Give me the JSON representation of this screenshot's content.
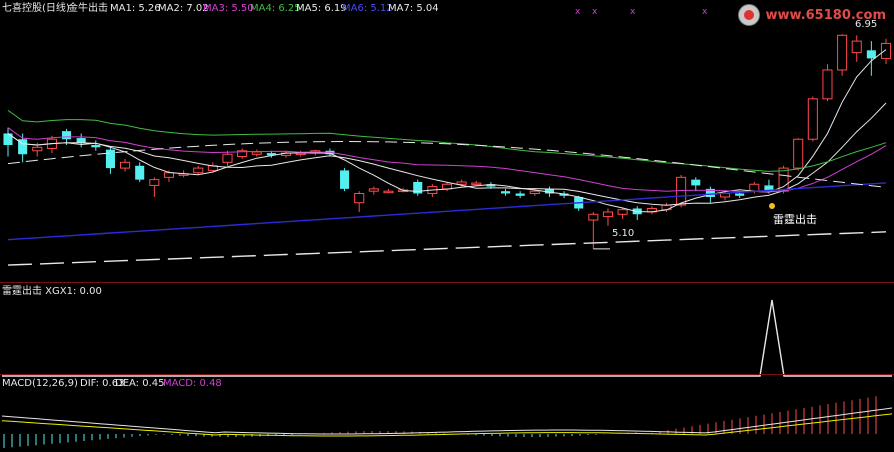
{
  "main_legend": {
    "stock": "七喜控股(日线)",
    "indicator": "金牛出击",
    "ma1": "MA1: 5.26",
    "ma2": "MA2: 7.02",
    "ma3": "MA3: 5.50",
    "ma4": "MA4: 6.25",
    "ma5": "MA5: 6.19",
    "ma6": "MA6: 5.12",
    "ma7": "MA7: 5.04"
  },
  "watermark": "www.65180.com",
  "annotations": {
    "high_price": "6.95",
    "low_price": "5.10",
    "signal": "雷霆出击"
  },
  "sub_pane1": {
    "legend": "雷霆出击 XGX1: 0.00"
  },
  "sub_pane2": {
    "legend_name": "MACD(12,26,9)",
    "dif": "DIF: 0.63",
    "dea": "DEA: 0.45",
    "macd": "MACD: 0.48"
  },
  "colors": {
    "up": "#ff4a4a",
    "down": "#54f0f0",
    "ma_white": "#e8e8e8",
    "ma_purple": "#d040d0",
    "ma_green": "#3fbf3f",
    "ma_blue": "#2b2bd8",
    "pane_border": "#7a1010"
  },
  "chart_data": {
    "type": "candlestick",
    "price_range": [
      4.9,
      7.1
    ],
    "candles": [
      {
        "o": 6.0,
        "c": 6.1,
        "h": 6.15,
        "l": 5.9,
        "up": false
      },
      {
        "o": 6.05,
        "c": 5.92,
        "h": 6.1,
        "l": 5.85,
        "up": false
      },
      {
        "o": 5.95,
        "c": 5.98,
        "h": 6.02,
        "l": 5.9,
        "up": true
      },
      {
        "o": 5.97,
        "c": 6.05,
        "h": 6.08,
        "l": 5.93,
        "up": true
      },
      {
        "o": 6.12,
        "c": 6.05,
        "h": 6.14,
        "l": 6.0,
        "up": false
      },
      {
        "o": 6.06,
        "c": 6.02,
        "h": 6.1,
        "l": 5.98,
        "up": false
      },
      {
        "o": 6.0,
        "c": 5.98,
        "h": 6.04,
        "l": 5.95,
        "up": false
      },
      {
        "o": 5.96,
        "c": 5.8,
        "h": 5.98,
        "l": 5.75,
        "up": false
      },
      {
        "o": 5.8,
        "c": 5.85,
        "h": 5.88,
        "l": 5.77,
        "up": true
      },
      {
        "o": 5.82,
        "c": 5.7,
        "h": 5.85,
        "l": 5.68,
        "up": false
      },
      {
        "o": 5.65,
        "c": 5.7,
        "h": 5.72,
        "l": 5.55,
        "up": true
      },
      {
        "o": 5.72,
        "c": 5.76,
        "h": 5.78,
        "l": 5.68,
        "up": true
      },
      {
        "o": 5.74,
        "c": 5.75,
        "h": 5.78,
        "l": 5.72,
        "up": true
      },
      {
        "o": 5.76,
        "c": 5.8,
        "h": 5.82,
        "l": 5.74,
        "up": true
      },
      {
        "o": 5.78,
        "c": 5.82,
        "h": 5.85,
        "l": 5.76,
        "up": true
      },
      {
        "o": 5.85,
        "c": 5.92,
        "h": 5.95,
        "l": 5.82,
        "up": true
      },
      {
        "o": 5.9,
        "c": 5.95,
        "h": 5.97,
        "l": 5.88,
        "up": true
      },
      {
        "o": 5.92,
        "c": 5.94,
        "h": 5.96,
        "l": 5.9,
        "up": true
      },
      {
        "o": 5.93,
        "c": 5.91,
        "h": 5.95,
        "l": 5.89,
        "up": false
      },
      {
        "o": 5.91,
        "c": 5.93,
        "h": 5.95,
        "l": 5.89,
        "up": true
      },
      {
        "o": 5.92,
        "c": 5.93,
        "h": 5.95,
        "l": 5.9,
        "up": true
      },
      {
        "o": 5.93,
        "c": 5.95,
        "h": 5.96,
        "l": 5.91,
        "up": true
      },
      {
        "o": 5.95,
        "c": 5.92,
        "h": 5.97,
        "l": 5.9,
        "up": false
      },
      {
        "o": 5.78,
        "c": 5.62,
        "h": 5.8,
        "l": 5.6,
        "up": false
      },
      {
        "o": 5.5,
        "c": 5.58,
        "h": 5.6,
        "l": 5.42,
        "up": true
      },
      {
        "o": 5.6,
        "c": 5.62,
        "h": 5.64,
        "l": 5.57,
        "up": true
      },
      {
        "o": 5.6,
        "c": 5.6,
        "h": 5.62,
        "l": 5.58,
        "up": true
      },
      {
        "o": 5.61,
        "c": 5.61,
        "h": 5.63,
        "l": 5.59,
        "up": true
      },
      {
        "o": 5.68,
        "c": 5.58,
        "h": 5.7,
        "l": 5.56,
        "up": false
      },
      {
        "o": 5.58,
        "c": 5.64,
        "h": 5.66,
        "l": 5.55,
        "up": true
      },
      {
        "o": 5.62,
        "c": 5.66,
        "h": 5.68,
        "l": 5.6,
        "up": true
      },
      {
        "o": 5.66,
        "c": 5.68,
        "h": 5.7,
        "l": 5.64,
        "up": true
      },
      {
        "o": 5.67,
        "c": 5.67,
        "h": 5.69,
        "l": 5.65,
        "up": true
      },
      {
        "o": 5.66,
        "c": 5.64,
        "h": 5.68,
        "l": 5.62,
        "up": false
      },
      {
        "o": 5.6,
        "c": 5.58,
        "h": 5.62,
        "l": 5.56,
        "up": false
      },
      {
        "o": 5.58,
        "c": 5.56,
        "h": 5.6,
        "l": 5.54,
        "up": false
      },
      {
        "o": 5.58,
        "c": 5.6,
        "h": 5.62,
        "l": 5.56,
        "up": true
      },
      {
        "o": 5.62,
        "c": 5.58,
        "h": 5.64,
        "l": 5.55,
        "up": false
      },
      {
        "o": 5.58,
        "c": 5.56,
        "h": 5.6,
        "l": 5.54,
        "up": false
      },
      {
        "o": 5.55,
        "c": 5.45,
        "h": 5.56,
        "l": 5.43,
        "up": false
      },
      {
        "o": 5.35,
        "c": 5.4,
        "h": 5.42,
        "l": 5.1,
        "up": true
      },
      {
        "o": 5.38,
        "c": 5.42,
        "h": 5.45,
        "l": 5.3,
        "up": true
      },
      {
        "o": 5.4,
        "c": 5.44,
        "h": 5.46,
        "l": 5.36,
        "up": true
      },
      {
        "o": 5.45,
        "c": 5.4,
        "h": 5.47,
        "l": 5.35,
        "up": false
      },
      {
        "o": 5.42,
        "c": 5.45,
        "h": 5.47,
        "l": 5.4,
        "up": true
      },
      {
        "o": 5.44,
        "c": 5.48,
        "h": 5.5,
        "l": 5.42,
        "up": true
      },
      {
        "o": 5.48,
        "c": 5.72,
        "h": 5.74,
        "l": 5.46,
        "up": true
      },
      {
        "o": 5.7,
        "c": 5.65,
        "h": 5.72,
        "l": 5.6,
        "up": false
      },
      {
        "o": 5.62,
        "c": 5.55,
        "h": 5.64,
        "l": 5.5,
        "up": false
      },
      {
        "o": 5.55,
        "c": 5.58,
        "h": 5.6,
        "l": 5.52,
        "up": true
      },
      {
        "o": 5.58,
        "c": 5.56,
        "h": 5.6,
        "l": 5.54,
        "up": false
      },
      {
        "o": 5.6,
        "c": 5.66,
        "h": 5.68,
        "l": 5.58,
        "up": true
      },
      {
        "o": 5.65,
        "c": 5.6,
        "h": 5.7,
        "l": 5.58,
        "up": false
      },
      {
        "o": 5.6,
        "c": 5.8,
        "h": 5.82,
        "l": 5.58,
        "up": true
      },
      {
        "o": 5.8,
        "c": 6.05,
        "h": 6.06,
        "l": 5.78,
        "up": true
      },
      {
        "o": 6.05,
        "c": 6.4,
        "h": 6.42,
        "l": 6.03,
        "up": true
      },
      {
        "o": 6.4,
        "c": 6.65,
        "h": 6.7,
        "l": 6.38,
        "up": true
      },
      {
        "o": 6.65,
        "c": 6.95,
        "h": 6.96,
        "l": 6.6,
        "up": true
      },
      {
        "o": 6.8,
        "c": 6.9,
        "h": 6.95,
        "l": 6.72,
        "up": true
      },
      {
        "o": 6.82,
        "c": 6.75,
        "h": 6.9,
        "l": 6.6,
        "up": false
      },
      {
        "o": 6.75,
        "c": 6.88,
        "h": 6.92,
        "l": 6.7,
        "up": true
      }
    ]
  }
}
